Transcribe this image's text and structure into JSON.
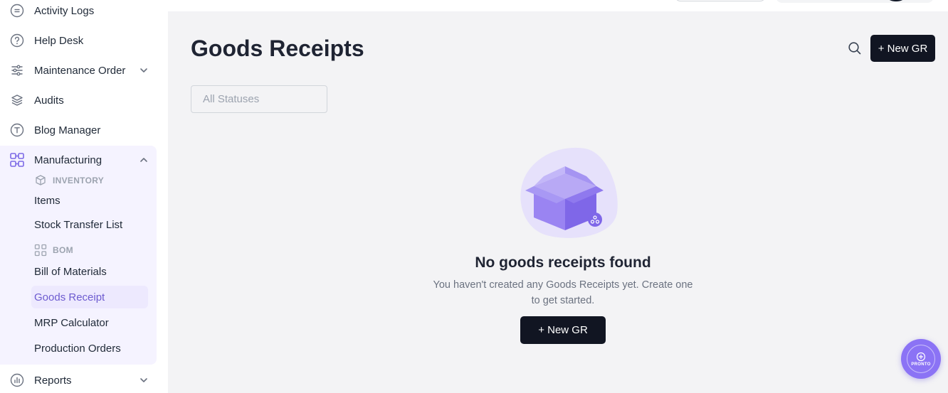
{
  "sidebar": {
    "items": [
      {
        "label": "Activity Logs",
        "icon": "list-square-icon"
      },
      {
        "label": "Help Desk",
        "icon": "question-circle-icon"
      },
      {
        "label": "Maintenance Order",
        "icon": "sliders-icon"
      },
      {
        "label": "Audits",
        "icon": "layers-icon"
      },
      {
        "label": "Blog Manager",
        "icon": "text-square-icon"
      },
      {
        "label": "Manufacturing",
        "icon": "grid-nodes-icon"
      },
      {
        "label": "Reports",
        "icon": "bar-chart-icon"
      }
    ],
    "inventory": {
      "heading": "INVENTORY",
      "items": [
        "Items",
        "Stock Transfer List"
      ]
    },
    "bom": {
      "heading": "BOM",
      "items": [
        "Bill of Materials",
        "Goods Receipt",
        "MRP Calculator",
        "Production Orders"
      ]
    },
    "active_item": "Goods Receipt"
  },
  "header": {
    "title": "Goods Receipts",
    "new_button_label": "+ New GR"
  },
  "filters": {
    "status_placeholder": "All Statuses"
  },
  "empty_state": {
    "title": "No goods receipts found",
    "description": "You haven't created any Goods Receipts yet. Create one to get started.",
    "button_label": "+ New GR"
  },
  "assistant": {
    "label": "PRONTO"
  },
  "colors": {
    "accent": "#8b73f5",
    "primary_button": "#111522",
    "active_text": "#6d5bd0",
    "background": "#f3f3f5"
  }
}
